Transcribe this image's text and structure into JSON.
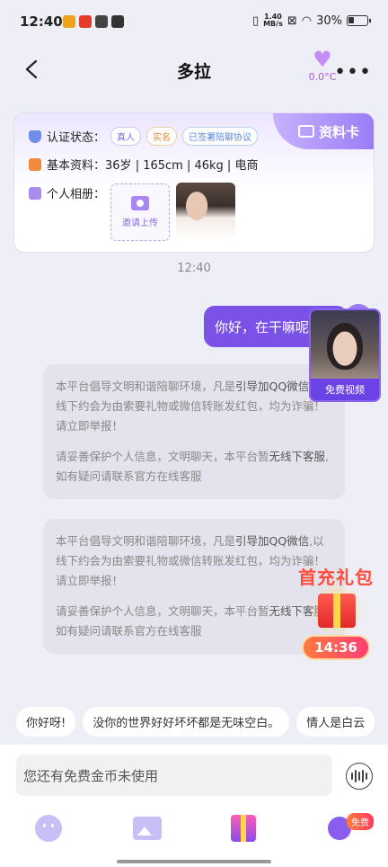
{
  "status_bar": {
    "time": "12:40",
    "net_speed_top": "1.40",
    "net_speed_unit": "MB/s",
    "battery": "30%"
  },
  "header": {
    "title": "多拉",
    "temperature": "0.0°C"
  },
  "profile_card": {
    "tag_label": "资料卡",
    "verify_label": "认证状态：",
    "badges": [
      "真人",
      "实名",
      "已签署陪聊协议"
    ],
    "basic_label": "基本资料：",
    "basic_value": "36岁 | 165cm | 46kg | 电商",
    "album_label": "个人相册：",
    "upload_label": "邀请上传"
  },
  "chat": {
    "timestamp": "12:40",
    "sent_message": "你好，在干嘛呢",
    "notices": [
      {
        "p1_a": "本平台倡导文明和谐陪聊环境，凡是",
        "p1_b": "引导加QQ微信",
        "p1_c": ",以线下约会为由索要礼物或微信转账发红包，均为诈骗！请立即举报！",
        "p2_a": "请妥善保护个人信息，文明聊天，本平台暂",
        "p2_b": "无线下客服",
        "p2_c": ",如有疑问请联系官方在线客服"
      },
      {
        "p1_a": "本平台倡导文明和谐陪聊环境，凡是",
        "p1_b": "引导加QQ微信",
        "p1_c": ",以线下约会为由索要礼物或微信转账发红包，均为诈骗！请立即举报！",
        "p2_a": "请妥善保护个人信息，文明聊天，本平台暂",
        "p2_b": "无线下客服",
        "p2_c": ",如有疑问请联系官方在线客服"
      }
    ]
  },
  "video_overlay": {
    "label": "免费视频"
  },
  "gift_overlay": {
    "title": "首充礼包",
    "timer": "14:36"
  },
  "quick_replies": [
    "你好呀!",
    "没你的世界好好坏坏都是无味空白。",
    "情人是白云"
  ],
  "input": {
    "placeholder": "您还有免费金币未使用"
  },
  "toolbar": {
    "free_badge": "免费"
  },
  "colors": {
    "accent": "#7b52e8",
    "background": "#eeeef7"
  }
}
